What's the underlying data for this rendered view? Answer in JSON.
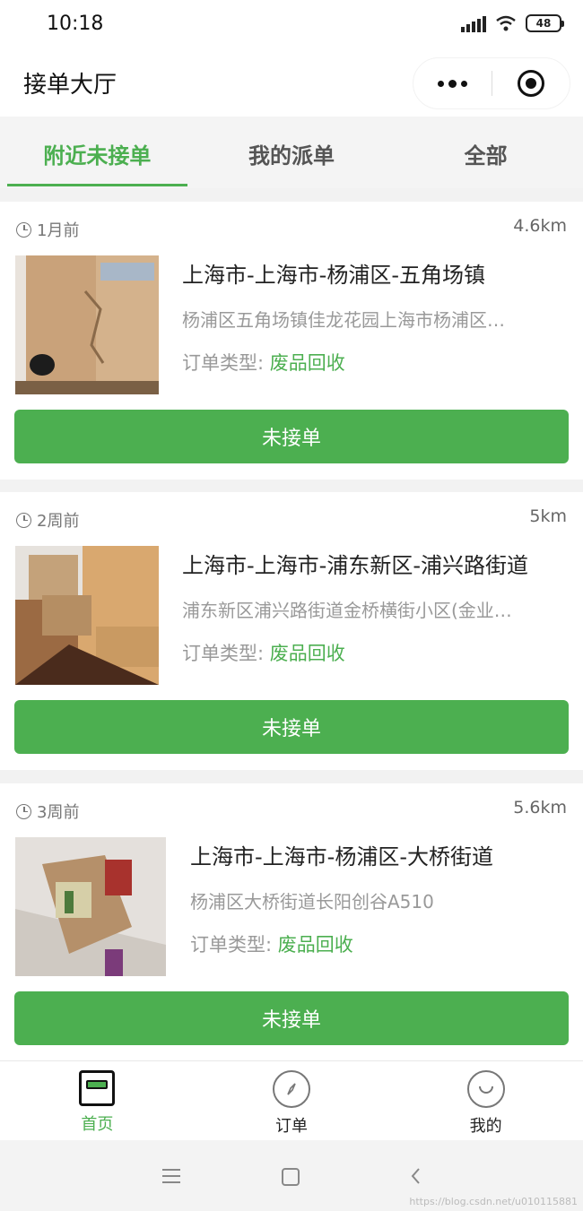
{
  "status": {
    "time": "10:18",
    "battery": "48"
  },
  "nav": {
    "title": "接单大厅"
  },
  "tabs": [
    {
      "label": "附近未接单",
      "active": true
    },
    {
      "label": "我的派单",
      "active": false
    },
    {
      "label": "全部",
      "active": false
    }
  ],
  "orders": [
    {
      "time": "1月前",
      "distance": "4.6km",
      "title": "上海市-上海市-杨浦区-五角场镇",
      "address": "杨浦区五角场镇佳龙花园上海市杨浦区…",
      "type_label": "订单类型:",
      "type_value": "废品回收",
      "button": "未接单"
    },
    {
      "time": "2周前",
      "distance": "5km",
      "title": "上海市-上海市-浦东新区-浦兴路街道",
      "address": "浦东新区浦兴路街道金桥横街小区(金业…",
      "type_label": "订单类型:",
      "type_value": "废品回收",
      "button": "未接单"
    },
    {
      "time": "3周前",
      "distance": "5.6km",
      "title": "上海市-上海市-杨浦区-大桥街道",
      "address": "杨浦区大桥街道长阳创谷A510",
      "type_label": "订单类型:",
      "type_value": "废品回收",
      "button": "未接单"
    }
  ],
  "tabbar": [
    {
      "label": "首页",
      "icon": "home-icon",
      "active": true
    },
    {
      "label": "订单",
      "icon": "compass-icon",
      "active": false
    },
    {
      "label": "我的",
      "icon": "smile-icon",
      "active": false
    }
  ],
  "watermark": "https://blog.csdn.net/u010115881",
  "colors": {
    "accent": "#4caf50",
    "background": "#f2f2f2"
  }
}
